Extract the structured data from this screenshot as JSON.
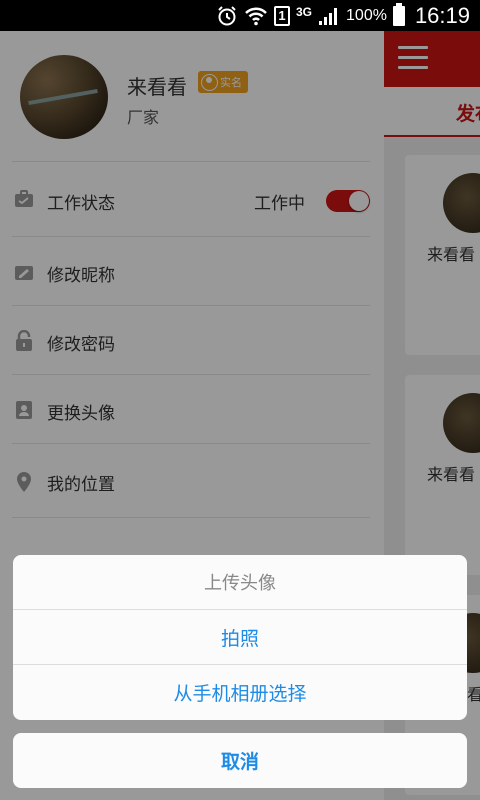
{
  "status_bar": {
    "battery": "100%",
    "time": "16:19",
    "network": "3G",
    "sim": "1",
    "icons": [
      "alarm-icon",
      "wifi-icon",
      "sim-icon",
      "signal-icon",
      "battery-icon"
    ]
  },
  "background": {
    "tab_label": "发布",
    "cards": [
      {
        "name": "来看看"
      },
      {
        "name": "来看看"
      },
      {
        "name": "看"
      }
    ]
  },
  "drawer": {
    "profile": {
      "name": "来看看",
      "badge": "实名",
      "role": "厂家"
    },
    "items": [
      {
        "label": "工作状态",
        "icon": "briefcase-icon"
      },
      {
        "label": "修改昵称",
        "icon": "edit-icon"
      },
      {
        "label": "修改密码",
        "icon": "lock-icon"
      },
      {
        "label": "更换头像",
        "icon": "contact-card-icon"
      },
      {
        "label": "我的位置",
        "icon": "location-pin-icon"
      }
    ],
    "work_status": {
      "text": "工作中",
      "on": true
    }
  },
  "action_sheet": {
    "title": "上传头像",
    "options": [
      "拍照",
      "从手机相册选择"
    ],
    "cancel": "取消"
  },
  "colors": {
    "accent": "#cc1414",
    "link_blue": "#1e8ce6",
    "badge": "#f0a020"
  }
}
